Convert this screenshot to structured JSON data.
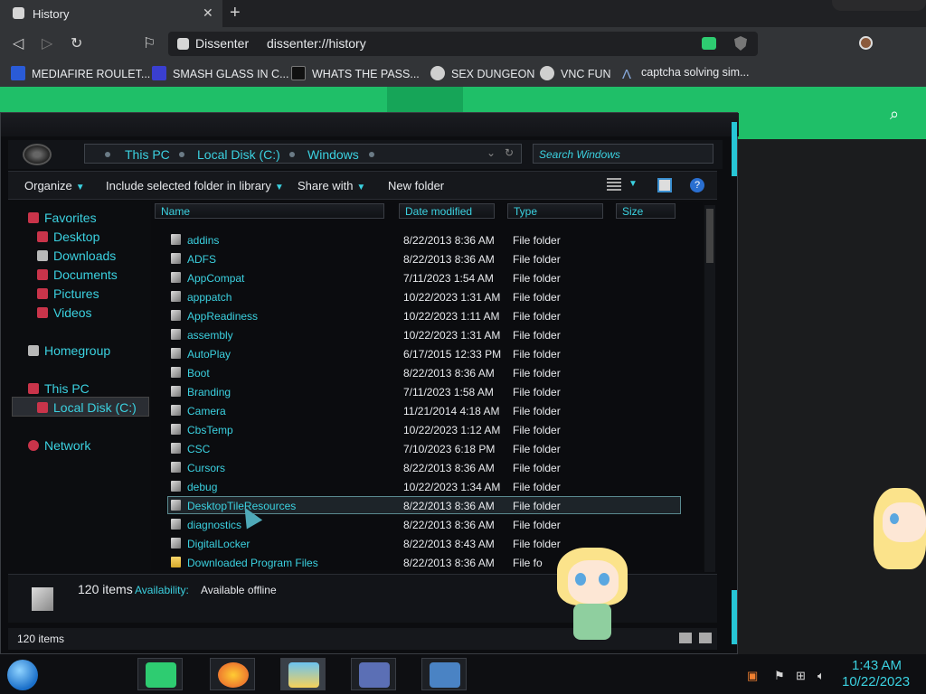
{
  "browser": {
    "tab_title": "History",
    "site_name": "Dissenter",
    "url": "dissenter://history",
    "bookmarks": [
      {
        "label": "MEDIAFIRE ROULET..."
      },
      {
        "label": "SMASH GLASS IN C..."
      },
      {
        "label": "WHATS THE PASS..."
      },
      {
        "label": "SEX DUNGEON"
      },
      {
        "label": "VNC FUN"
      },
      {
        "label": "captcha solving sim..."
      }
    ]
  },
  "explorer": {
    "breadcrumbs": [
      "This PC",
      "Local Disk (C:)",
      "Windows"
    ],
    "search_placeholder": "Search Windows",
    "commands": {
      "organize": "Organize",
      "include": "Include selected folder in library",
      "share": "Share with",
      "new_folder": "New folder"
    },
    "nav": {
      "favorites": "Favorites",
      "desktop": "Desktop",
      "downloads": "Downloads",
      "documents": "Documents",
      "pictures": "Pictures",
      "videos": "Videos",
      "homegroup": "Homegroup",
      "this_pc": "This PC",
      "local_disk": "Local Disk (C:)",
      "network": "Network"
    },
    "columns": {
      "name": "Name",
      "date": "Date modified",
      "type": "Type",
      "size": "Size"
    },
    "rows": [
      {
        "name": "addins",
        "date": "8/22/2013 8:36 AM",
        "type": "File folder"
      },
      {
        "name": "ADFS",
        "date": "8/22/2013 8:36 AM",
        "type": "File folder"
      },
      {
        "name": "AppCompat",
        "date": "7/11/2023 1:54 AM",
        "type": "File folder"
      },
      {
        "name": "apppatch",
        "date": "10/22/2023 1:31 AM",
        "type": "File folder"
      },
      {
        "name": "AppReadiness",
        "date": "10/22/2023 1:11 AM",
        "type": "File folder"
      },
      {
        "name": "assembly",
        "date": "10/22/2023 1:31 AM",
        "type": "File folder"
      },
      {
        "name": "AutoPlay",
        "date": "6/17/2015 12:33 PM",
        "type": "File folder"
      },
      {
        "name": "Boot",
        "date": "8/22/2013 8:36 AM",
        "type": "File folder"
      },
      {
        "name": "Branding",
        "date": "7/11/2023 1:58 AM",
        "type": "File folder"
      },
      {
        "name": "Camera",
        "date": "11/21/2014 4:18 AM",
        "type": "File folder"
      },
      {
        "name": "CbsTemp",
        "date": "10/22/2023 1:12 AM",
        "type": "File folder"
      },
      {
        "name": "CSC",
        "date": "7/10/2023 6:18 PM",
        "type": "File folder"
      },
      {
        "name": "Cursors",
        "date": "8/22/2013 8:36 AM",
        "type": "File folder"
      },
      {
        "name": "debug",
        "date": "10/22/2023 1:34 AM",
        "type": "File folder"
      },
      {
        "name": "DesktopTileResources",
        "date": "8/22/2013 8:36 AM",
        "type": "File folder"
      },
      {
        "name": "diagnostics",
        "date": "8/22/2013 8:36 AM",
        "type": "File folder"
      },
      {
        "name": "DigitalLocker",
        "date": "8/22/2013 8:43 AM",
        "type": "File folder"
      },
      {
        "name": "Downloaded Program Files",
        "date": "8/22/2013 8:36 AM",
        "type": "File fo"
      }
    ],
    "details": {
      "count": "120 items",
      "availability_label": "Availability:",
      "availability_value": "Available offline"
    },
    "status": "120 items"
  },
  "taskbar": {
    "time": "1:43 AM",
    "date": "10/22/2023"
  },
  "colors": {
    "accent": "#3bd1e0",
    "page_green": "#1fbf68"
  }
}
